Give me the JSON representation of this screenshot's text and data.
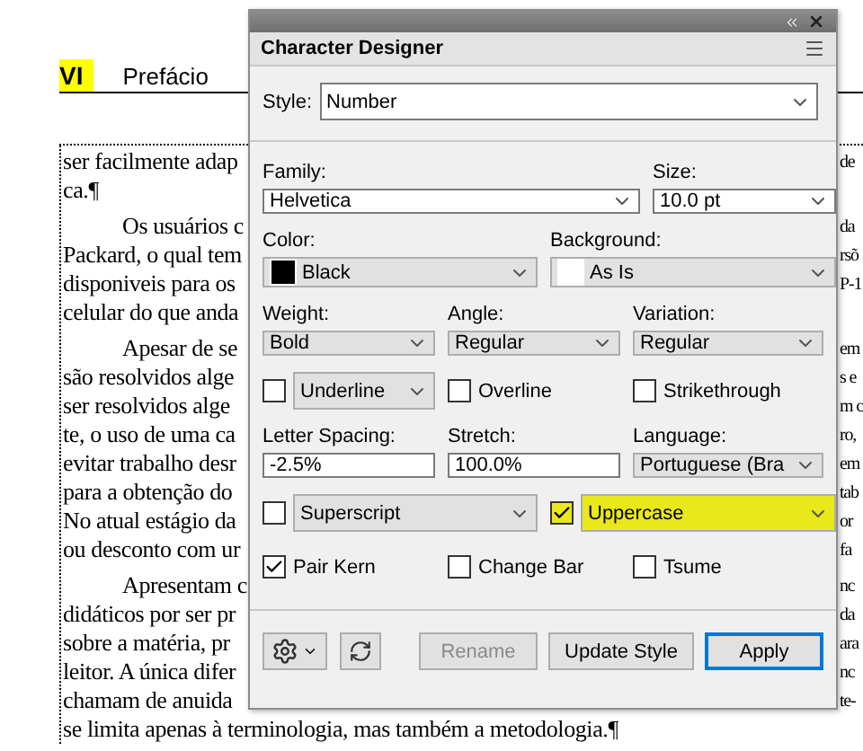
{
  "document": {
    "heading": {
      "number": "VI",
      "highlighted": true,
      "title": "Prefácio"
    },
    "paragraphs": [
      {
        "indented": false,
        "lines": [
          {
            "text": "ser facilmente adap",
            "edge": "de"
          },
          {
            "text": "ca.¶"
          }
        ]
      },
      {
        "indented": true,
        "lines": [
          {
            "text": "Os usuários c",
            "edge": "da"
          },
          {
            "text": "Packard, o qual tem",
            "edge": "rsõ"
          },
          {
            "text": "disponiveis para os",
            "edge": "P-1"
          },
          {
            "text": "celular do que anda"
          }
        ]
      },
      {
        "indented": true,
        "lines": [
          {
            "text": "Apesar de se",
            "edge": "em"
          },
          {
            "text": "são resolvidos alge",
            "edge": "s e"
          },
          {
            "text": "ser resolvidos alge",
            "edge": "m c"
          },
          {
            "text": "te, o uso de uma ca",
            "edge": "ro,"
          },
          {
            "text": "evitar trabalho desr",
            "edge": "em"
          },
          {
            "text": "para a obtenção do",
            "edge": "tab"
          },
          {
            "text": "No atual estágio da",
            "edge": "or"
          },
          {
            "text": "ou desconto com ur",
            "edge": "fa"
          }
        ]
      },
      {
        "indented": true,
        "lines": [
          {
            "text": "Apresentam c",
            "edge": "nc"
          },
          {
            "text": "didáticos por ser pr",
            "edge": "da"
          },
          {
            "text": "sobre a matéria, pr",
            "edge": "ara"
          },
          {
            "text": "leitor. A única difer",
            "edge": "nc"
          },
          {
            "text": "chamam de anuida",
            "edge": "te-"
          },
          {
            "text": "se limita apenas à terminologia, mas também a metodologia.¶"
          }
        ]
      }
    ]
  },
  "dialog": {
    "title": "Character Designer",
    "style": {
      "label": "Style:",
      "value": "Number"
    },
    "rows": [
      {
        "kind": "wide-narrow",
        "items": [
          {
            "kind": "combo",
            "label": "Family:",
            "value": "Helvetica"
          },
          {
            "kind": "combo",
            "label": "Size:",
            "value": "10.0 pt"
          }
        ]
      },
      {
        "kind": "halves",
        "items": [
          {
            "kind": "swatch",
            "label": "Color:",
            "value": "Black",
            "color": "#000000"
          },
          {
            "kind": "swatch",
            "label": "Background:",
            "value": "As Is",
            "color": "#ffffff"
          }
        ]
      },
      {
        "kind": "thirds",
        "items": [
          {
            "kind": "select",
            "label": "Weight:",
            "value": "Bold"
          },
          {
            "kind": "select",
            "label": "Angle:",
            "value": "Regular"
          },
          {
            "kind": "select",
            "label": "Variation:",
            "value": "Regular"
          }
        ]
      },
      {
        "kind": "thirds",
        "items": [
          {
            "kind": "check-select",
            "value": "Underline",
            "checked": false,
            "highlighted": false
          },
          {
            "kind": "check",
            "value": "Overline",
            "checked": false
          },
          {
            "kind": "check",
            "value": "Strikethrough",
            "checked": false
          }
        ]
      },
      {
        "kind": "thirds",
        "items": [
          {
            "kind": "input",
            "label": "Letter Spacing:",
            "value": "-2.5%"
          },
          {
            "kind": "input",
            "label": "Stretch:",
            "value": "100.0%"
          },
          {
            "kind": "select",
            "label": "Language:",
            "value": "Portuguese (Bra"
          }
        ]
      },
      {
        "kind": "halves",
        "items": [
          {
            "kind": "check-select",
            "value": "Superscript",
            "checked": false,
            "highlighted": false
          },
          {
            "kind": "check-select",
            "value": "Uppercase",
            "checked": true,
            "highlighted": true
          }
        ]
      },
      {
        "kind": "thirds",
        "items": [
          {
            "kind": "check",
            "value": "Pair Kern",
            "checked": true
          },
          {
            "kind": "check",
            "value": "Change Bar",
            "checked": false
          },
          {
            "kind": "check",
            "value": "Tsume",
            "checked": false
          }
        ]
      }
    ],
    "buttons": [
      {
        "label": "Rename",
        "disabled": true,
        "default": false
      },
      {
        "label": "Update Style",
        "disabled": false,
        "default": false
      },
      {
        "label": "Apply",
        "disabled": false,
        "default": true
      }
    ]
  }
}
